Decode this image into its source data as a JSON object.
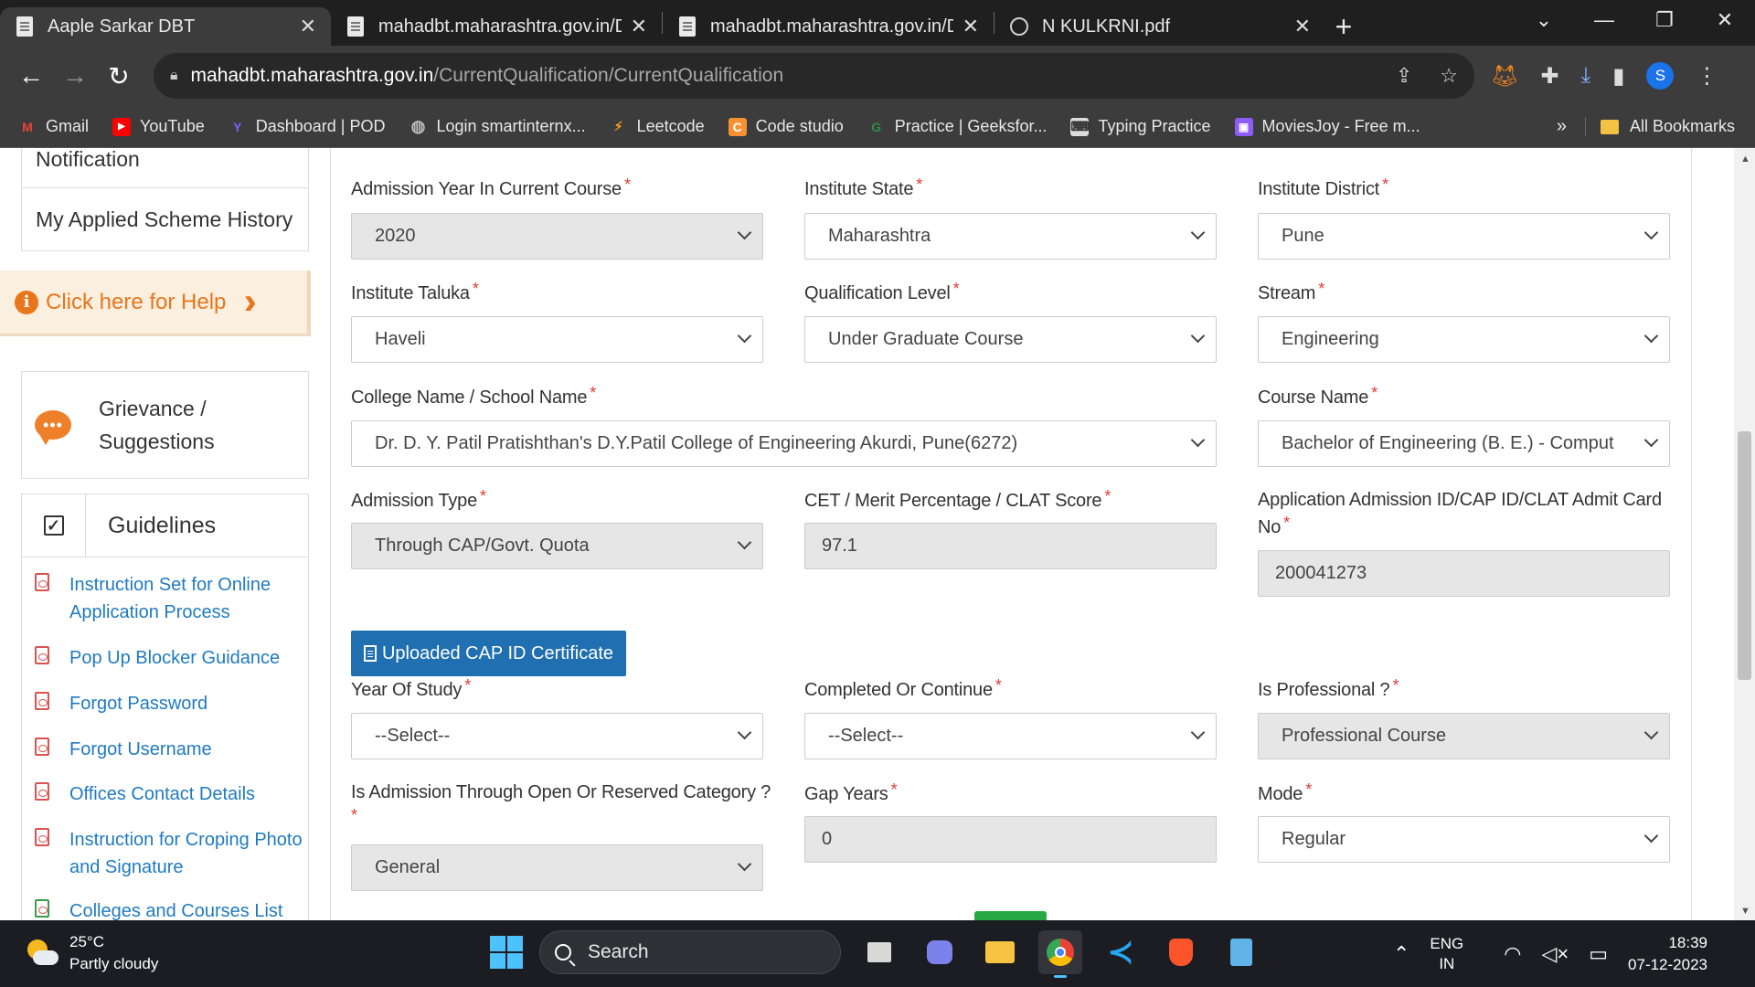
{
  "browser": {
    "tabs": [
      {
        "title": "Aaple Sarkar DBT",
        "active": true,
        "icon": "document-icon"
      },
      {
        "title": "mahadbt.maharashtra.gov.in/DB",
        "active": false,
        "icon": "document-icon"
      },
      {
        "title": "mahadbt.maharashtra.gov.in/DB",
        "active": false,
        "icon": "document-icon"
      },
      {
        "title": "N KULKRNI.pdf",
        "active": false,
        "icon": "globe-icon"
      }
    ],
    "url_host": "mahadbt.maharashtra.gov.in",
    "url_path": "/CurrentQualification/CurrentQualification",
    "profile_initial": "S",
    "bookmarks": [
      {
        "label": "Gmail",
        "icon": "gmail-icon",
        "color": "#ea4335",
        "glyph": "M"
      },
      {
        "label": "YouTube",
        "icon": "youtube-icon",
        "color": "#ff0000",
        "glyph": "▶"
      },
      {
        "label": "Dashboard | POD",
        "icon": "pod-icon",
        "color": "#7b61ff",
        "glyph": "Y"
      },
      {
        "label": "Login smartinternx...",
        "icon": "globe-icon",
        "color": "#5f6368",
        "glyph": "◍"
      },
      {
        "label": "Leetcode",
        "icon": "leetcode-icon",
        "color": "#ffa116",
        "glyph": "⚡"
      },
      {
        "label": "Code studio",
        "icon": "codestudio-icon",
        "color": "#f79032",
        "glyph": "C"
      },
      {
        "label": "Practice | Geeksfor...",
        "icon": "gfg-icon",
        "color": "#2f8d46",
        "glyph": "G"
      },
      {
        "label": "Typing Practice",
        "icon": "typing-icon",
        "color": "#9e9e9e",
        "glyph": "⌨"
      },
      {
        "label": "MoviesJoy - Free m...",
        "icon": "moviesjoy-icon",
        "color": "#8e5cf7",
        "glyph": "▣"
      }
    ],
    "bookmarks_more": "»",
    "all_bookmarks": "All Bookmarks"
  },
  "sidebar": {
    "notification": "Notification",
    "applied_history": "My Applied Scheme History",
    "help": "Click here for Help",
    "grievance": "Grievance / Suggestions",
    "guidelines": "Guidelines",
    "links": [
      "Instruction Set for Online Application Process",
      "Pop Up Blocker Guidance",
      "Forgot Password",
      "Forgot Username",
      "Offices Contact Details",
      "Instruction for Croping Photo and Signature",
      "Colleges and Courses List"
    ]
  },
  "form": {
    "admission_year": {
      "label": "Admission Year In Current Course",
      "value": "2020"
    },
    "institute_state": {
      "label": "Institute State",
      "value": "Maharashtra"
    },
    "institute_district": {
      "label": "Institute District",
      "value": "Pune"
    },
    "institute_taluka": {
      "label": "Institute Taluka",
      "value": "Haveli"
    },
    "qualification_level": {
      "label": "Qualification Level",
      "value": "Under Graduate Course"
    },
    "stream": {
      "label": "Stream",
      "value": "Engineering"
    },
    "college_name": {
      "label": "College Name / School Name",
      "value": "Dr. D. Y. Patil Pratishthan's D.Y.Patil College of Engineering Akurdi, Pune(6272)"
    },
    "course_name": {
      "label": "Course Name",
      "value": "Bachelor of Engineering (B. E.) - Computer E"
    },
    "admission_type": {
      "label": "Admission Type",
      "value": "Through CAP/Govt. Quota"
    },
    "cet_score": {
      "label": "CET / Merit Percentage / CLAT Score",
      "value": "97.1"
    },
    "admission_id": {
      "label": "Application Admission ID/CAP ID/CLAT Admit Card No",
      "value": "200041273"
    },
    "cap_button": "Uploaded CAP ID Certificate",
    "year_of_study": {
      "label": "Year Of Study",
      "value": "--Select--"
    },
    "completed_continue": {
      "label": "Completed Or Continue",
      "value": "--Select--"
    },
    "is_professional": {
      "label": "Is Professional ?",
      "value": "Professional Course"
    },
    "admission_category": {
      "label": "Is Admission Through Open Or Reserved Category ?",
      "value": "General"
    },
    "gap_years": {
      "label": "Gap Years",
      "value": "0"
    },
    "mode": {
      "label": "Mode",
      "value": "Regular"
    },
    "required_mark": "*"
  },
  "taskbar": {
    "temperature": "25°C",
    "weather": "Partly cloudy",
    "search": "Search",
    "lang_top": "ENG",
    "lang_bottom": "IN",
    "time": "18:39",
    "date": "07-12-2023"
  }
}
